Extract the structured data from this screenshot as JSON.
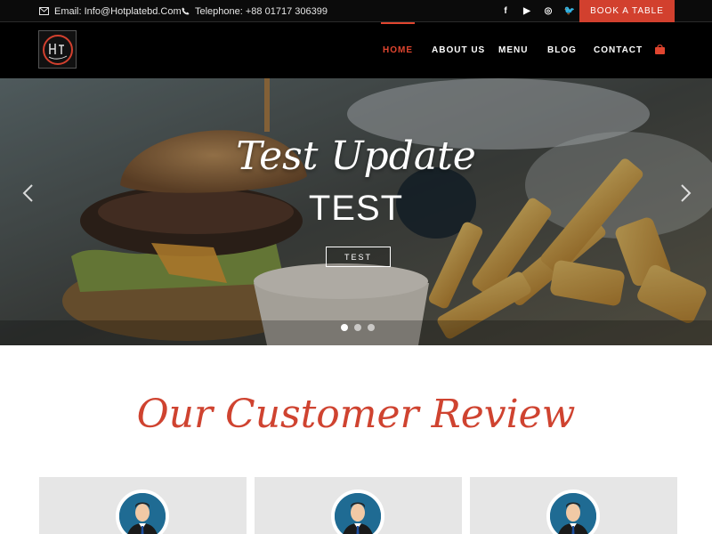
{
  "topbar": {
    "email": "Email: Info@Hotplatebd.Com",
    "telephone": "Telephone: +88 01717 306399",
    "social": [
      {
        "icon": "facebook-icon",
        "glyph": "f"
      },
      {
        "icon": "youtube-icon",
        "glyph": "▶"
      },
      {
        "icon": "instagram-icon",
        "glyph": "◎"
      },
      {
        "icon": "twitter-icon",
        "glyph": "🐦"
      }
    ],
    "book_label": "BOOK A TABLE"
  },
  "nav": {
    "items": [
      {
        "label": "HOME",
        "active": true
      },
      {
        "label": "ABOUT US",
        "active": false
      },
      {
        "label": "MENU",
        "active": false
      },
      {
        "label": "BLOG",
        "active": false
      },
      {
        "label": "CONTACT",
        "active": false
      }
    ],
    "cart_icon": "shopping-bag-icon"
  },
  "hero": {
    "title": "Test Update",
    "subtitle": "TEST",
    "button_label": "TEST",
    "slide_count": 3,
    "active_slide": 1
  },
  "reviews": {
    "title": "Our Customer Review",
    "card_count": 3
  },
  "colors": {
    "accent": "#d2402e",
    "topbar_bg": "#0b0b0b",
    "header_bg": "#000000",
    "card_bg": "#e6e6e6"
  }
}
